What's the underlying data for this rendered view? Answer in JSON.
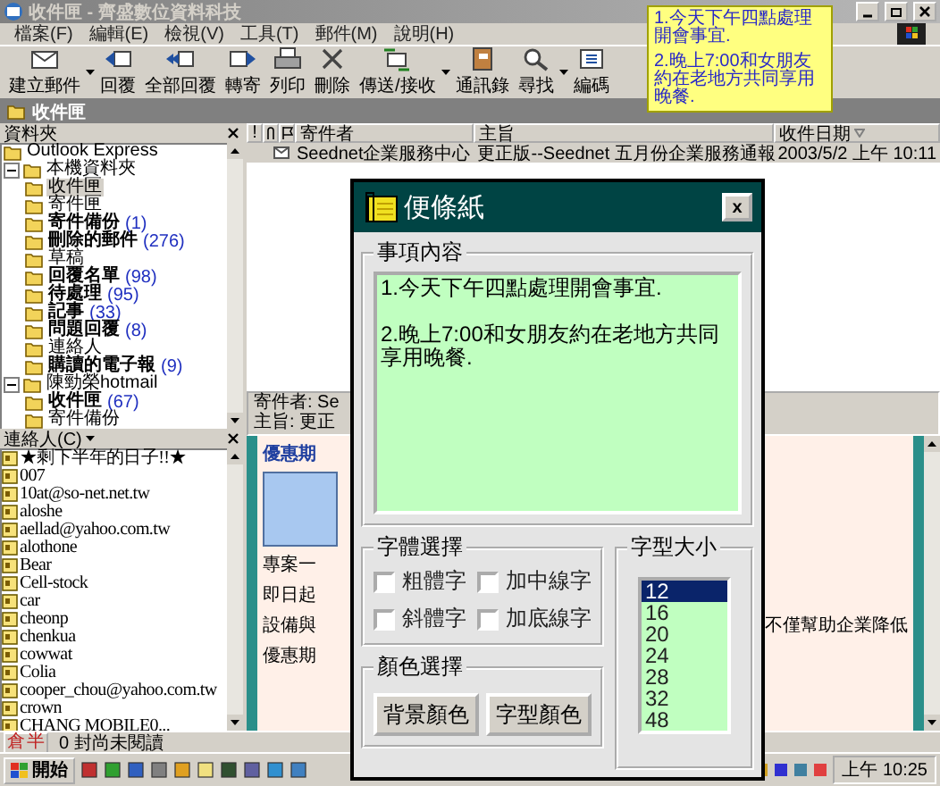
{
  "window": {
    "title": "收件匣 - 齊盛數位資料科技"
  },
  "menu": [
    "檔案(F)",
    "編輯(E)",
    "檢視(V)",
    "工具(T)",
    "郵件(M)",
    "說明(H)"
  ],
  "toolbar": [
    {
      "label": "建立郵件",
      "dropdown": true
    },
    {
      "label": "回覆",
      "dropdown": false
    },
    {
      "label": "全部回覆",
      "dropdown": false
    },
    {
      "label": "轉寄",
      "dropdown": false
    },
    {
      "label": "列印",
      "dropdown": false
    },
    {
      "label": "刪除",
      "dropdown": false
    },
    {
      "label": "傳送/接收",
      "dropdown": true
    },
    {
      "label": "通訊錄",
      "dropdown": false
    },
    {
      "label": "尋找",
      "dropdown": true
    },
    {
      "label": "編碼",
      "dropdown": false
    }
  ],
  "folder_bar": {
    "title": "收件匣"
  },
  "folder_pane": {
    "title": "資料夾",
    "tree": [
      {
        "label": "Outlook Express",
        "selected": false
      },
      {
        "label": "本機資料夾",
        "selected": false,
        "expanded": true,
        "children": [
          {
            "label": "收件匣",
            "selected": true
          },
          {
            "label": "寄件匣",
            "selected": false
          },
          {
            "label": "寄件備份",
            "count": "(1)",
            "selected": false
          },
          {
            "label": "刪除的郵件",
            "count": "(276)",
            "selected": false
          },
          {
            "label": "草稿",
            "selected": false
          },
          {
            "label": "回覆名單",
            "count": "(98)",
            "selected": false
          },
          {
            "label": "待處理",
            "count": "(95)",
            "selected": false
          },
          {
            "label": "記事",
            "count": "(33)",
            "selected": false
          },
          {
            "label": "問題回覆",
            "count": "(8)",
            "selected": false
          },
          {
            "label": "連絡人",
            "selected": false
          },
          {
            "label": "購讀的電子報",
            "count": "(9)",
            "selected": false
          }
        ]
      },
      {
        "label": "陳勁榮hotmail",
        "selected": false,
        "expanded": true,
        "children": [
          {
            "label": "收件匣",
            "count": "(67)",
            "selected": false
          },
          {
            "label": "寄件備份",
            "selected": false
          }
        ]
      }
    ]
  },
  "contacts": {
    "title": "連絡人(C)",
    "items": [
      "★剩下半年的日子!!★",
      "007",
      "10at@so-net.net.tw",
      "aloshe",
      "aellad@yahoo.com.tw",
      "alothone",
      "Bear",
      "Cell-stock",
      "car",
      "cheonp",
      "chenkua",
      "cowwat",
      "Colia",
      "cooper_chou@yahoo.com.tw",
      "crown",
      "CHANG MOBILE0..."
    ]
  },
  "message_list": {
    "columns": [
      "!",
      "寄件者",
      "主旨",
      "收件日期"
    ],
    "rows": [
      {
        "from": "Seednet企業服務中心",
        "subject": "更正版--Seednet 五月份企業服務通報",
        "received": "2003/5/2 上午 10:11",
        "selected": true
      }
    ]
  },
  "preview": {
    "header": [
      "寄件者: Se",
      "主旨: 更正"
    ],
    "heading": "優惠期",
    "lines": [
      {
        "left": "專案一"
      },
      {
        "left": "即日起"
      },
      {
        "left": "設備與",
        "right": "不僅幫助企業降低"
      },
      {
        "left": "優惠期"
      }
    ]
  },
  "status_bar": {
    "ime": [
      "倉",
      "半"
    ],
    "text": "0 封尚未閱讀"
  },
  "taskbar": {
    "start": "開始",
    "clock": "上午 10:25"
  },
  "sticky_note": {
    "lines": [
      "1.今天下午四點處理開會事宜.",
      "2.晚上7:00和女朋友約在老地方共同享用晚餐."
    ]
  },
  "dialog": {
    "title": "便條紙",
    "close": "x",
    "content_group": "事項內容",
    "content": "1.今天下午四點處理開會事宜.\n\n2.晚上7:00和女朋友約在老地方共同享用晚餐.",
    "style_group": "字體選擇",
    "styles": [
      {
        "label": "粗體字",
        "checked": false
      },
      {
        "label": "加中線字",
        "checked": false
      },
      {
        "label": "斜體字",
        "checked": false
      },
      {
        "label": "加底線字",
        "checked": false
      }
    ],
    "color_group": "顏色選擇",
    "color_buttons": [
      "背景顏色",
      "字型顏色"
    ],
    "size_group": "字型大小",
    "sizes": [
      {
        "label": "12",
        "selected": true
      },
      {
        "label": "16",
        "selected": false
      },
      {
        "label": "20",
        "selected": false
      },
      {
        "label": "24",
        "selected": false
      },
      {
        "label": "28",
        "selected": false
      },
      {
        "label": "32",
        "selected": false
      },
      {
        "label": "48",
        "selected": false
      }
    ]
  }
}
